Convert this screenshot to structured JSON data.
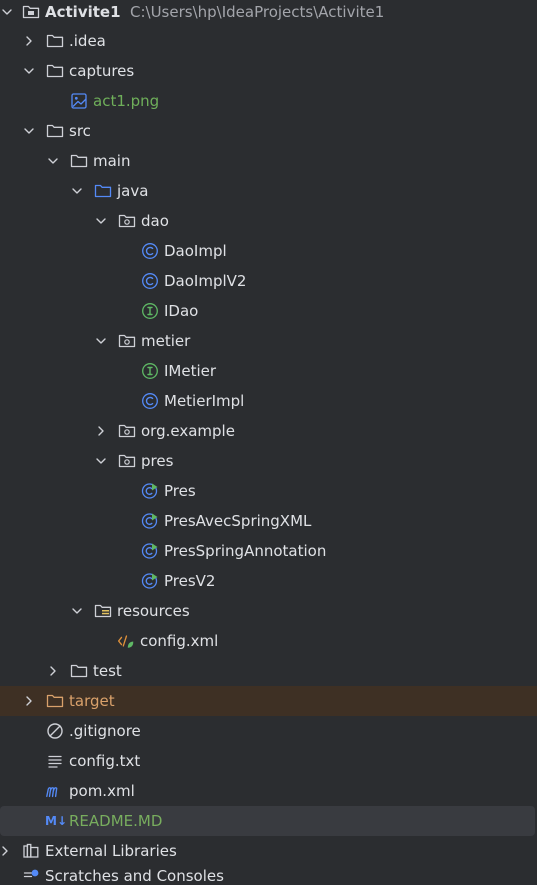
{
  "root": {
    "label": "Activite1",
    "path": "C:\\Users\\hp\\IdeaProjects\\Activite1"
  },
  "tree": {
    "idea": ".idea",
    "captures": "captures",
    "act1": "act1.png",
    "src": "src",
    "main": "main",
    "java": "java",
    "dao": "dao",
    "daoimpl": "DaoImpl",
    "daoimplv2": "DaoImplV2",
    "idao": "IDao",
    "metier": "metier",
    "imetier": "IMetier",
    "metierimpl": "MetierImpl",
    "orgexample": "org.example",
    "pres": "pres",
    "pres_class": "Pres",
    "presavec": "PresAvecSpringXML",
    "presspring": "PresSpringAnnotation",
    "presv2": "PresV2",
    "resources": "resources",
    "configxml": "config.xml",
    "test": "test",
    "target": "target",
    "gitignore": ".gitignore",
    "configtxt": "config.txt",
    "pom": "pom.xml",
    "readme": "README.MD",
    "extlibs": "External Libraries",
    "scratches": "Scratches and Consoles"
  },
  "icons": {
    "readme_badge": "M↓"
  },
  "colors": {
    "background": "#2b2d30",
    "text": "#dfe1e5",
    "class_icon": "#548af7",
    "interface_icon": "#5fb865",
    "image_text": "#6faf5a",
    "excluded": "#d9a16b",
    "selection": "#393b40"
  }
}
